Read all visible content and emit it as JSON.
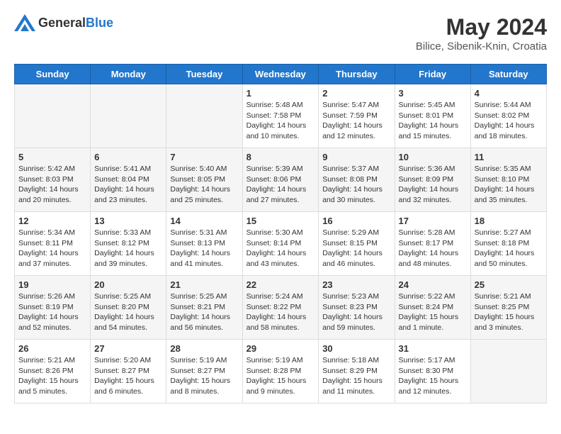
{
  "header": {
    "logo_general": "General",
    "logo_blue": "Blue",
    "title": "May 2024",
    "location": "Bilice, Sibenik-Knin, Croatia"
  },
  "weekdays": [
    "Sunday",
    "Monday",
    "Tuesday",
    "Wednesday",
    "Thursday",
    "Friday",
    "Saturday"
  ],
  "weeks": [
    [
      {
        "day": "",
        "sunrise": "",
        "sunset": "",
        "daylight": "",
        "empty": true
      },
      {
        "day": "",
        "sunrise": "",
        "sunset": "",
        "daylight": "",
        "empty": true
      },
      {
        "day": "",
        "sunrise": "",
        "sunset": "",
        "daylight": "",
        "empty": true
      },
      {
        "day": "1",
        "sunrise": "Sunrise: 5:48 AM",
        "sunset": "Sunset: 7:58 PM",
        "daylight": "Daylight: 14 hours and 10 minutes."
      },
      {
        "day": "2",
        "sunrise": "Sunrise: 5:47 AM",
        "sunset": "Sunset: 7:59 PM",
        "daylight": "Daylight: 14 hours and 12 minutes."
      },
      {
        "day": "3",
        "sunrise": "Sunrise: 5:45 AM",
        "sunset": "Sunset: 8:01 PM",
        "daylight": "Daylight: 14 hours and 15 minutes."
      },
      {
        "day": "4",
        "sunrise": "Sunrise: 5:44 AM",
        "sunset": "Sunset: 8:02 PM",
        "daylight": "Daylight: 14 hours and 18 minutes."
      }
    ],
    [
      {
        "day": "5",
        "sunrise": "Sunrise: 5:42 AM",
        "sunset": "Sunset: 8:03 PM",
        "daylight": "Daylight: 14 hours and 20 minutes."
      },
      {
        "day": "6",
        "sunrise": "Sunrise: 5:41 AM",
        "sunset": "Sunset: 8:04 PM",
        "daylight": "Daylight: 14 hours and 23 minutes."
      },
      {
        "day": "7",
        "sunrise": "Sunrise: 5:40 AM",
        "sunset": "Sunset: 8:05 PM",
        "daylight": "Daylight: 14 hours and 25 minutes."
      },
      {
        "day": "8",
        "sunrise": "Sunrise: 5:39 AM",
        "sunset": "Sunset: 8:06 PM",
        "daylight": "Daylight: 14 hours and 27 minutes."
      },
      {
        "day": "9",
        "sunrise": "Sunrise: 5:37 AM",
        "sunset": "Sunset: 8:08 PM",
        "daylight": "Daylight: 14 hours and 30 minutes."
      },
      {
        "day": "10",
        "sunrise": "Sunrise: 5:36 AM",
        "sunset": "Sunset: 8:09 PM",
        "daylight": "Daylight: 14 hours and 32 minutes."
      },
      {
        "day": "11",
        "sunrise": "Sunrise: 5:35 AM",
        "sunset": "Sunset: 8:10 PM",
        "daylight": "Daylight: 14 hours and 35 minutes."
      }
    ],
    [
      {
        "day": "12",
        "sunrise": "Sunrise: 5:34 AM",
        "sunset": "Sunset: 8:11 PM",
        "daylight": "Daylight: 14 hours and 37 minutes."
      },
      {
        "day": "13",
        "sunrise": "Sunrise: 5:33 AM",
        "sunset": "Sunset: 8:12 PM",
        "daylight": "Daylight: 14 hours and 39 minutes."
      },
      {
        "day": "14",
        "sunrise": "Sunrise: 5:31 AM",
        "sunset": "Sunset: 8:13 PM",
        "daylight": "Daylight: 14 hours and 41 minutes."
      },
      {
        "day": "15",
        "sunrise": "Sunrise: 5:30 AM",
        "sunset": "Sunset: 8:14 PM",
        "daylight": "Daylight: 14 hours and 43 minutes."
      },
      {
        "day": "16",
        "sunrise": "Sunrise: 5:29 AM",
        "sunset": "Sunset: 8:15 PM",
        "daylight": "Daylight: 14 hours and 46 minutes."
      },
      {
        "day": "17",
        "sunrise": "Sunrise: 5:28 AM",
        "sunset": "Sunset: 8:17 PM",
        "daylight": "Daylight: 14 hours and 48 minutes."
      },
      {
        "day": "18",
        "sunrise": "Sunrise: 5:27 AM",
        "sunset": "Sunset: 8:18 PM",
        "daylight": "Daylight: 14 hours and 50 minutes."
      }
    ],
    [
      {
        "day": "19",
        "sunrise": "Sunrise: 5:26 AM",
        "sunset": "Sunset: 8:19 PM",
        "daylight": "Daylight: 14 hours and 52 minutes."
      },
      {
        "day": "20",
        "sunrise": "Sunrise: 5:25 AM",
        "sunset": "Sunset: 8:20 PM",
        "daylight": "Daylight: 14 hours and 54 minutes."
      },
      {
        "day": "21",
        "sunrise": "Sunrise: 5:25 AM",
        "sunset": "Sunset: 8:21 PM",
        "daylight": "Daylight: 14 hours and 56 minutes."
      },
      {
        "day": "22",
        "sunrise": "Sunrise: 5:24 AM",
        "sunset": "Sunset: 8:22 PM",
        "daylight": "Daylight: 14 hours and 58 minutes."
      },
      {
        "day": "23",
        "sunrise": "Sunrise: 5:23 AM",
        "sunset": "Sunset: 8:23 PM",
        "daylight": "Daylight: 14 hours and 59 minutes."
      },
      {
        "day": "24",
        "sunrise": "Sunrise: 5:22 AM",
        "sunset": "Sunset: 8:24 PM",
        "daylight": "Daylight: 15 hours and 1 minute."
      },
      {
        "day": "25",
        "sunrise": "Sunrise: 5:21 AM",
        "sunset": "Sunset: 8:25 PM",
        "daylight": "Daylight: 15 hours and 3 minutes."
      }
    ],
    [
      {
        "day": "26",
        "sunrise": "Sunrise: 5:21 AM",
        "sunset": "Sunset: 8:26 PM",
        "daylight": "Daylight: 15 hours and 5 minutes."
      },
      {
        "day": "27",
        "sunrise": "Sunrise: 5:20 AM",
        "sunset": "Sunset: 8:27 PM",
        "daylight": "Daylight: 15 hours and 6 minutes."
      },
      {
        "day": "28",
        "sunrise": "Sunrise: 5:19 AM",
        "sunset": "Sunset: 8:27 PM",
        "daylight": "Daylight: 15 hours and 8 minutes."
      },
      {
        "day": "29",
        "sunrise": "Sunrise: 5:19 AM",
        "sunset": "Sunset: 8:28 PM",
        "daylight": "Daylight: 15 hours and 9 minutes."
      },
      {
        "day": "30",
        "sunrise": "Sunrise: 5:18 AM",
        "sunset": "Sunset: 8:29 PM",
        "daylight": "Daylight: 15 hours and 11 minutes."
      },
      {
        "day": "31",
        "sunrise": "Sunrise: 5:17 AM",
        "sunset": "Sunset: 8:30 PM",
        "daylight": "Daylight: 15 hours and 12 minutes."
      },
      {
        "day": "",
        "sunrise": "",
        "sunset": "",
        "daylight": "",
        "empty": true
      }
    ]
  ]
}
